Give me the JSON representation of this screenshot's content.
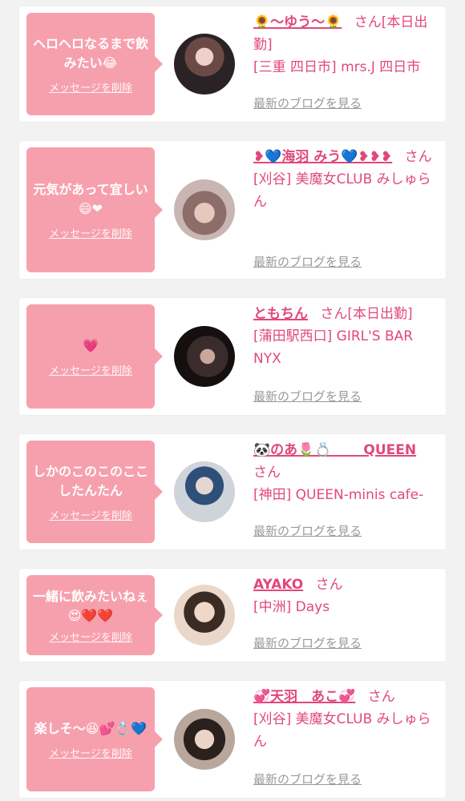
{
  "colors": {
    "accent": "#e2487a",
    "bubble": "#f7a0ad",
    "link_gray": "#999999"
  },
  "delete_label": "メッセージを削除",
  "blog_label": "最新のブログを見る",
  "san": "さん",
  "items": [
    {
      "message": "ヘロヘロなるまで飲みたい😂",
      "name": "🌻〜ゆう〜🌻",
      "status": "[本日出勤]",
      "shop": "[三重 四日市] mrs.J 四日市"
    },
    {
      "message": "元気があって宜しい😄❤",
      "name": "❥💙海羽 みう💙❥❥❥",
      "status": "",
      "shop": "[刈谷] 美魔女CLUB みしゅらん"
    },
    {
      "message": "💗",
      "name": "ともちん",
      "status": "[本日出勤]",
      "shop": "[蒲田駅西口] GIRL'S BAR NYX"
    },
    {
      "message": "しかのこのこのここしたんたん",
      "name": "🐼のあ🌷💍 　　QUEEN",
      "status": "",
      "shop": "[神田] QUEEN-minis cafe-"
    },
    {
      "message": "一緒に飲みたいねぇ😍❤️❤️",
      "name": "AYAKO",
      "status": "",
      "shop": "[中洲] Days"
    },
    {
      "message": "楽しそ〜😆💕💍💙",
      "name": "💞天羽　あこ💞",
      "status": "",
      "shop": "[刈谷] 美魔女CLUB みしゅらん"
    }
  ]
}
